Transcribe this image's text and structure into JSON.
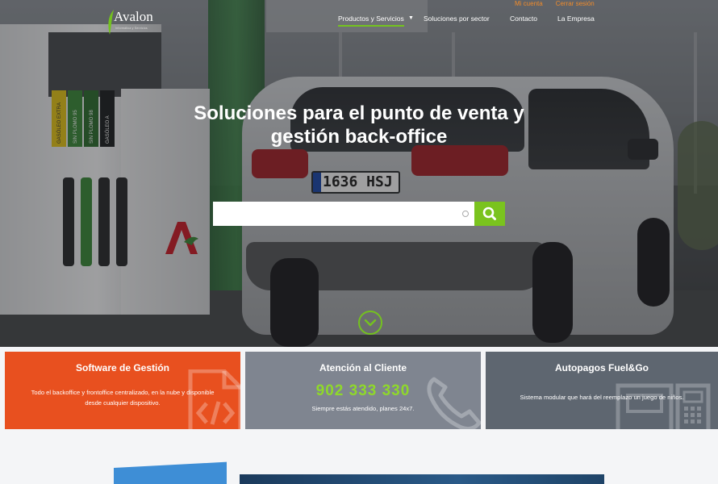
{
  "brand": {
    "name": "Avalon",
    "tagline": "Informática y Servicios",
    "mark_color": "#74c21f"
  },
  "account": {
    "my_account": "Mi cuenta",
    "logout": "Cerrar sesión",
    "link_color": "#f08b2b"
  },
  "nav": {
    "active_color": "#74c21f",
    "items": [
      {
        "label": "Productos y Servicios",
        "active": true,
        "has_dropdown": true
      },
      {
        "label": "Soluciones por sector",
        "active": false
      },
      {
        "label": "Contacto",
        "active": false
      },
      {
        "label": "La Empresa",
        "active": false
      }
    ]
  },
  "hero": {
    "headline_line1_regular": "Soluciones para el",
    "headline_line1_bold": "punto de venta",
    "headline_line1_end": "y",
    "headline_line2": "gestión back-office",
    "plate_text": "1636 HSJ",
    "fuel_labels": [
      "GASÓLEO EXTRA",
      "SIN PLOMO 95",
      "SIN PLOMO 98",
      "GASÓLEO A"
    ],
    "search": {
      "value": "",
      "placeholder": "",
      "button_color": "#7ac31e",
      "button_icon": "search-icon"
    },
    "scroll_icon": "chevron-down-icon"
  },
  "cards": [
    {
      "title": "Software de Gestión",
      "text_line1": "Todo el backoffice y frontoffice centralizado, en la nube y disponible",
      "text_line2": "desde cualquier dispositivo.",
      "color": "#e8501f",
      "icon": "code-file-icon"
    },
    {
      "title": "Atención al Cliente",
      "phone": "902 333 330",
      "text_line1": "Siempre estás atendido, planes 24x7.",
      "color": "#7f8590",
      "icon": "phone-icon"
    },
    {
      "title": "Autopagos Fuel&Go",
      "text_line1": "Sistema modular que hará del reemplazo un juego de niños.",
      "color": "#5e6670",
      "icon": "kiosk-icon"
    }
  ]
}
